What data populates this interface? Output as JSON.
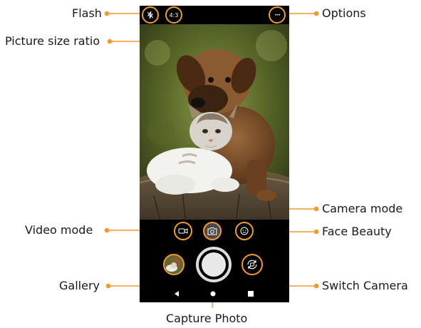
{
  "callouts": {
    "flash": "Flash",
    "picture_size_ratio": "Picture size ratio",
    "options": "Options",
    "camera_mode": "Camera mode",
    "video_mode": "Video mode",
    "face_beauty": "Face Beauty",
    "gallery": "Gallery",
    "switch_camera": "Switch Camera",
    "capture_photo": "Capture Photo"
  },
  "topbar": {
    "ratio_label": "4:3",
    "options_glyph": "•••"
  },
  "icons": {
    "flash": "flash-off-icon",
    "ratio": "aspect-ratio-icon",
    "options": "more-horizontal-icon",
    "video": "video-camera-icon",
    "camera": "camera-icon",
    "beauty": "face-smile-icon",
    "gallery": "gallery-thumbnail",
    "shutter": "shutter-button",
    "switch": "switch-camera-icon",
    "back": "nav-back-icon",
    "home": "nav-home-icon",
    "recents": "nav-recents-icon"
  },
  "colors": {
    "accent": "#f39a2d",
    "background": "#ffffff",
    "phone": "#000000",
    "text": "#1a1a1a"
  }
}
